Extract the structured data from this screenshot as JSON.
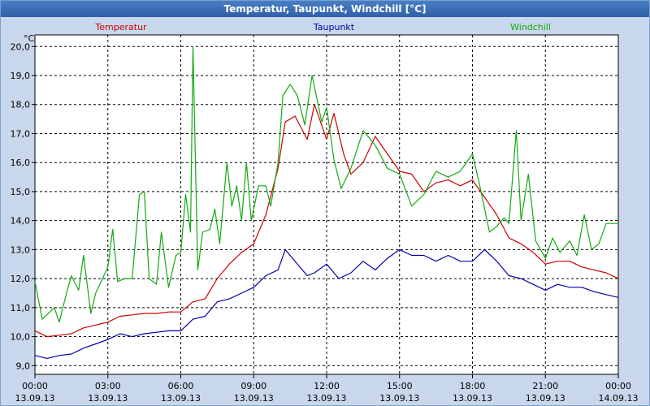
{
  "window": {
    "title": "Temperatur, Taupunkt, Windchill [°C]"
  },
  "colors": {
    "background": "#c9d7ec",
    "plot_background": "#ffffff",
    "grid": "#000000"
  },
  "chart_data": {
    "type": "line",
    "title": "Temperatur, Taupunkt, Windchill [°C]",
    "ylabel": "°C",
    "ylim": [
      8.7,
      20.4
    ],
    "yticks": [
      "9,0",
      "10,0",
      "11,0",
      "12,0",
      "13,0",
      "14,0",
      "15,0",
      "16,0",
      "17,0",
      "18,0",
      "19,0",
      "20,0"
    ],
    "ytick_values": [
      9,
      10,
      11,
      12,
      13,
      14,
      15,
      16,
      17,
      18,
      19,
      20
    ],
    "xlim": [
      0,
      24
    ],
    "xticks": [
      {
        "time": "00:00",
        "date": "13.09.13",
        "hour": 0
      },
      {
        "time": "03:00",
        "date": "13.09.13",
        "hour": 3
      },
      {
        "time": "06:00",
        "date": "13.09.13",
        "hour": 6
      },
      {
        "time": "09:00",
        "date": "13.09.13",
        "hour": 9
      },
      {
        "time": "12:00",
        "date": "13.09.13",
        "hour": 12
      },
      {
        "time": "15:00",
        "date": "13.09.13",
        "hour": 15
      },
      {
        "time": "18:00",
        "date": "13.09.13",
        "hour": 18
      },
      {
        "time": "21:00",
        "date": "13.09.13",
        "hour": 21
      },
      {
        "time": "00:00",
        "date": "14.09.13",
        "hour": 24
      }
    ],
    "grid": true,
    "legend_placement": "top",
    "series": [
      {
        "name": "Temperatur",
        "color": "#cc0000",
        "points": [
          [
            0,
            10.2
          ],
          [
            0.5,
            10.0
          ],
          [
            1,
            10.05
          ],
          [
            1.5,
            10.1
          ],
          [
            2,
            10.3
          ],
          [
            2.5,
            10.4
          ],
          [
            3,
            10.5
          ],
          [
            3.5,
            10.7
          ],
          [
            4,
            10.75
          ],
          [
            4.5,
            10.8
          ],
          [
            5,
            10.8
          ],
          [
            5.5,
            10.85
          ],
          [
            6,
            10.85
          ],
          [
            6.5,
            11.2
          ],
          [
            7,
            11.3
          ],
          [
            7.5,
            12.0
          ],
          [
            8,
            12.5
          ],
          [
            8.5,
            12.9
          ],
          [
            9,
            13.2
          ],
          [
            9.5,
            14.2
          ],
          [
            10,
            15.8
          ],
          [
            10.3,
            17.4
          ],
          [
            10.7,
            17.6
          ],
          [
            11.2,
            16.8
          ],
          [
            11.5,
            18.0
          ],
          [
            12,
            16.8
          ],
          [
            12.3,
            17.7
          ],
          [
            12.7,
            16.3
          ],
          [
            13,
            15.6
          ],
          [
            13.5,
            16.0
          ],
          [
            14,
            16.9
          ],
          [
            14.5,
            16.3
          ],
          [
            15,
            15.7
          ],
          [
            15.5,
            15.6
          ],
          [
            16,
            15.0
          ],
          [
            16.5,
            15.3
          ],
          [
            17,
            15.4
          ],
          [
            17.5,
            15.2
          ],
          [
            18,
            15.4
          ],
          [
            18.5,
            14.8
          ],
          [
            19,
            14.2
          ],
          [
            19.5,
            13.4
          ],
          [
            20,
            13.2
          ],
          [
            20.5,
            12.9
          ],
          [
            21,
            12.5
          ],
          [
            21.5,
            12.6
          ],
          [
            22,
            12.6
          ],
          [
            22.5,
            12.4
          ],
          [
            23,
            12.3
          ],
          [
            23.5,
            12.2
          ],
          [
            24,
            12.0
          ]
        ]
      },
      {
        "name": "Taupunkt",
        "color": "#0000aa",
        "points": [
          [
            0,
            9.35
          ],
          [
            0.5,
            9.25
          ],
          [
            1,
            9.35
          ],
          [
            1.5,
            9.4
          ],
          [
            2,
            9.6
          ],
          [
            2.5,
            9.75
          ],
          [
            3,
            9.9
          ],
          [
            3.5,
            10.1
          ],
          [
            4,
            10.0
          ],
          [
            4.5,
            10.1
          ],
          [
            5,
            10.15
          ],
          [
            5.5,
            10.2
          ],
          [
            6,
            10.2
          ],
          [
            6.5,
            10.6
          ],
          [
            7,
            10.7
          ],
          [
            7.5,
            11.2
          ],
          [
            8,
            11.3
          ],
          [
            8.5,
            11.5
          ],
          [
            9,
            11.7
          ],
          [
            9.5,
            12.1
          ],
          [
            10,
            12.3
          ],
          [
            10.3,
            13.0
          ],
          [
            10.7,
            12.6
          ],
          [
            11.2,
            12.1
          ],
          [
            11.5,
            12.2
          ],
          [
            12,
            12.5
          ],
          [
            12.5,
            12.0
          ],
          [
            13,
            12.2
          ],
          [
            13.5,
            12.6
          ],
          [
            14,
            12.3
          ],
          [
            14.5,
            12.7
          ],
          [
            15,
            13.0
          ],
          [
            15.5,
            12.8
          ],
          [
            16,
            12.8
          ],
          [
            16.5,
            12.6
          ],
          [
            17,
            12.8
          ],
          [
            17.5,
            12.6
          ],
          [
            18,
            12.6
          ],
          [
            18.5,
            13.0
          ],
          [
            19,
            12.6
          ],
          [
            19.5,
            12.1
          ],
          [
            20,
            12.0
          ],
          [
            20.5,
            11.8
          ],
          [
            21,
            11.6
          ],
          [
            21.5,
            11.8
          ],
          [
            22,
            11.7
          ],
          [
            22.5,
            11.7
          ],
          [
            23,
            11.55
          ],
          [
            23.5,
            11.45
          ],
          [
            24,
            11.35
          ]
        ]
      },
      {
        "name": "Windchill",
        "color": "#11aa11",
        "points": [
          [
            0,
            11.9
          ],
          [
            0.3,
            10.6
          ],
          [
            0.8,
            11.0
          ],
          [
            1,
            10.5
          ],
          [
            1.3,
            11.5
          ],
          [
            1.5,
            12.1
          ],
          [
            1.8,
            11.6
          ],
          [
            2,
            12.8
          ],
          [
            2.3,
            10.8
          ],
          [
            2.5,
            11.5
          ],
          [
            3,
            12.4
          ],
          [
            3.2,
            13.7
          ],
          [
            3.4,
            11.9
          ],
          [
            3.7,
            12.0
          ],
          [
            4,
            12.0
          ],
          [
            4.3,
            14.9
          ],
          [
            4.5,
            15.0
          ],
          [
            4.7,
            12.0
          ],
          [
            5,
            11.8
          ],
          [
            5.2,
            13.6
          ],
          [
            5.5,
            11.7
          ],
          [
            5.8,
            12.8
          ],
          [
            6,
            12.9
          ],
          [
            6.2,
            14.9
          ],
          [
            6.4,
            13.6
          ],
          [
            6.5,
            20.0
          ],
          [
            6.7,
            12.3
          ],
          [
            6.9,
            13.6
          ],
          [
            7.2,
            13.7
          ],
          [
            7.4,
            14.4
          ],
          [
            7.6,
            13.2
          ],
          [
            7.9,
            16.0
          ],
          [
            8.1,
            14.5
          ],
          [
            8.3,
            15.2
          ],
          [
            8.5,
            14.0
          ],
          [
            8.7,
            16.0
          ],
          [
            8.9,
            14.0
          ],
          [
            9.2,
            15.2
          ],
          [
            9.5,
            15.2
          ],
          [
            9.7,
            14.5
          ],
          [
            10,
            16.0
          ],
          [
            10.2,
            18.3
          ],
          [
            10.5,
            18.7
          ],
          [
            10.8,
            18.3
          ],
          [
            11.1,
            17.3
          ],
          [
            11.4,
            19.0
          ],
          [
            11.8,
            17.4
          ],
          [
            12,
            17.9
          ],
          [
            12.3,
            16.1
          ],
          [
            12.6,
            15.1
          ],
          [
            13,
            15.8
          ],
          [
            13.5,
            17.1
          ],
          [
            14,
            16.6
          ],
          [
            14.5,
            15.8
          ],
          [
            15,
            15.6
          ],
          [
            15.5,
            14.5
          ],
          [
            16,
            14.9
          ],
          [
            16.5,
            15.7
          ],
          [
            17,
            15.5
          ],
          [
            17.5,
            15.7
          ],
          [
            18,
            16.3
          ],
          [
            18.3,
            15.2
          ],
          [
            18.7,
            13.6
          ],
          [
            19,
            13.8
          ],
          [
            19.3,
            14.1
          ],
          [
            19.5,
            13.9
          ],
          [
            19.8,
            17.1
          ],
          [
            20,
            14.0
          ],
          [
            20.3,
            15.6
          ],
          [
            20.6,
            13.3
          ],
          [
            21,
            12.7
          ],
          [
            21.3,
            13.4
          ],
          [
            21.6,
            12.9
          ],
          [
            22,
            13.3
          ],
          [
            22.3,
            12.8
          ],
          [
            22.6,
            14.2
          ],
          [
            22.9,
            13.0
          ],
          [
            23.2,
            13.2
          ],
          [
            23.5,
            13.9
          ],
          [
            24,
            13.9
          ]
        ]
      }
    ]
  }
}
